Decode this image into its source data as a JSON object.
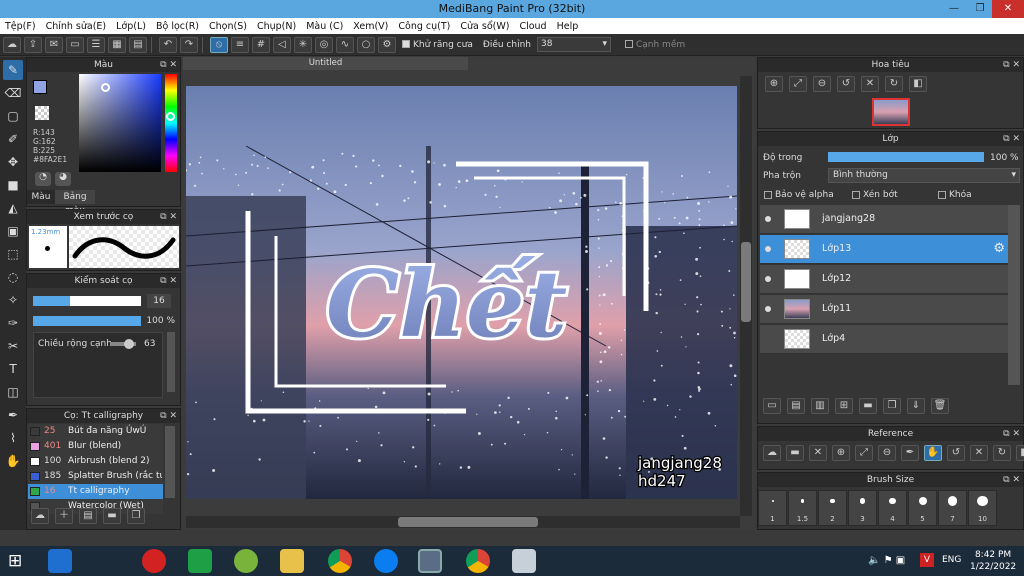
{
  "window": {
    "title": "MediBang Paint Pro (32bit)"
  },
  "menu": [
    "Tệp(F)",
    "Chỉnh sửa(E)",
    "Lớp(L)",
    "Bộ lọc(R)",
    "Chọn(S)",
    "Chụp(N)",
    "Màu (C)",
    "Xem(V)",
    "Công cụ(T)",
    "Cửa sổ(W)",
    "Cloud",
    "Help"
  ],
  "toolbar": {
    "antialias_label": "Khử răng cưa",
    "adjust_label": "Điều chỉnh",
    "adjust_value": "38",
    "smooth_label": "Cạnh mềm"
  },
  "color_panel": {
    "title": "Màu",
    "r": "R:143",
    "g": "G:162",
    "b": "B:225",
    "hex": "#8FA2E1",
    "tab1": "Màu",
    "tab2": "Bảng màu",
    "fg": "#8FA2E1"
  },
  "brush_preview": {
    "title": "Xem trước cọ",
    "size": "1.23mm"
  },
  "brush_control": {
    "title": "Kiểm soát cọ",
    "size": "16",
    "opacity": "100 %",
    "edge_label": "Chiều rộng cạnh",
    "edge_value": "63"
  },
  "brush_list": {
    "title": "Cọ: Tt calligraphy",
    "items": [
      {
        "num": "25",
        "name": "Bút đa năng ÚwÚ",
        "color": "#3a3a3a"
      },
      {
        "num": "401",
        "name": "Blur (blend)",
        "color": "#e8a0e0"
      },
      {
        "num": "100",
        "name": "Airbrush (blend 2)",
        "color": "#ffffff"
      },
      {
        "num": "185",
        "name": "Splatter Brush (rắc tuyết)",
        "color": "#3a5fd0"
      },
      {
        "num": "16",
        "name": "Tt calligraphy",
        "color": "#2ea84a"
      },
      {
        "num": "",
        "name": "Watercolor (Wet)",
        "color": "#555"
      }
    ]
  },
  "document": {
    "tab": "Untitled",
    "art_text": "Chết",
    "watermark_1": "jangjang28",
    "watermark_2": "hd247"
  },
  "navigator": {
    "title": "Hoa tiêu"
  },
  "layers": {
    "title": "Lớp",
    "opacity_label": "Độ trong",
    "opacity_value": "100 %",
    "blend_label": "Pha trộn",
    "blend_value": "Bình thường",
    "protect_alpha": "Bảo vệ alpha",
    "clip": "Xén bớt",
    "lock": "Khóa",
    "items": [
      {
        "name": "jangjang28"
      },
      {
        "name": "Lớp13"
      },
      {
        "name": "Lớp12"
      },
      {
        "name": "Lớp11"
      },
      {
        "name": "Lớp4"
      }
    ]
  },
  "reference": {
    "title": "Reference"
  },
  "brush_size": {
    "title": "Brush Size",
    "sizes": [
      "1",
      "1.5",
      "2",
      "3",
      "4",
      "5",
      "7",
      "10"
    ]
  },
  "taskbar": {
    "lang": "ENG",
    "time": "8:42 PM",
    "date": "1/22/2022"
  }
}
